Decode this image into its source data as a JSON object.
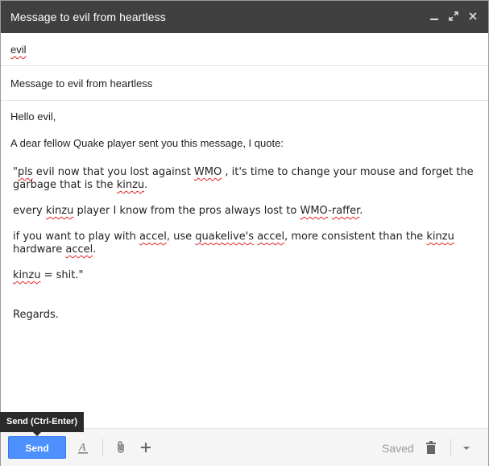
{
  "window": {
    "title": "Message to evil from heartless"
  },
  "header_icons": [
    "minimize-icon",
    "expand-icon",
    "close-icon"
  ],
  "to": {
    "recipient": "evil"
  },
  "subject": {
    "value": "Message to evil from heartless"
  },
  "body": {
    "greeting": "Hello evil,",
    "intro": "A dear fellow Quake player sent you this message, I quote:",
    "quote_lines": [
      "\"pls evil now that you lost against WMO , it's time to change your mouse and forget the garbage that is the kinzu.",
      "every kinzu player I know from the pros always lost to WMO-raffer.",
      "if you want to play with accel, use quakelive's accel, more consistent than the kinzu hardware accel.",
      "kinzu = shit.\""
    ],
    "signoff": "Regards."
  },
  "toolbar": {
    "send_label": "Send",
    "send_tooltip": "Send (Ctrl-Enter)",
    "saved_status": "Saved",
    "icons": [
      "formatting-icon",
      "attach-icon",
      "more-icon",
      "discard-icon",
      "options-dropdown-icon"
    ]
  },
  "colors": {
    "titlebar": "#404040",
    "send_button": "#4d90fe",
    "spellcheck": "#dd2222"
  }
}
